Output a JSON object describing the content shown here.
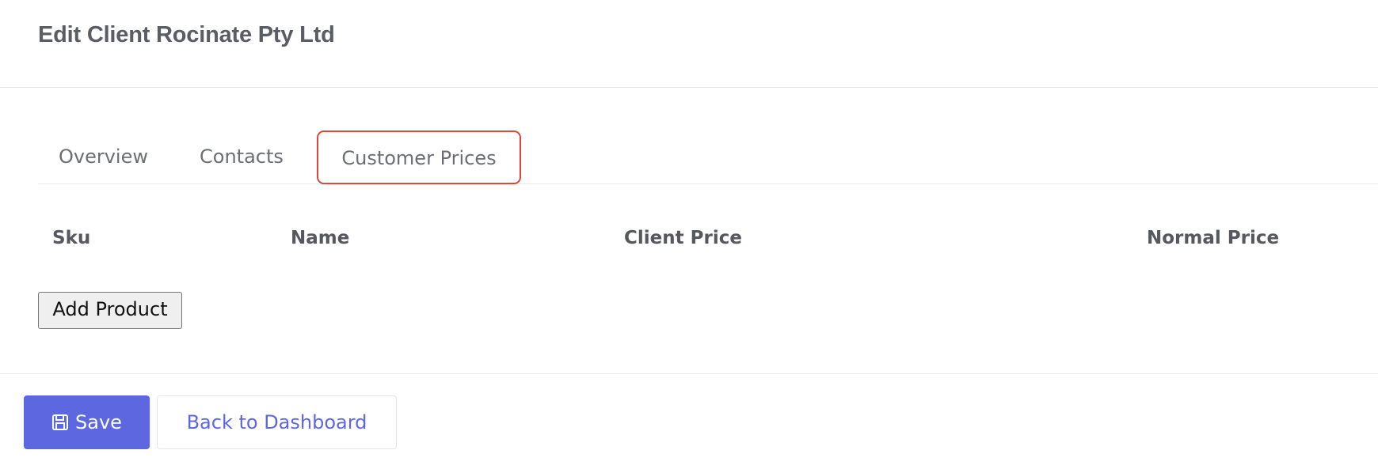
{
  "header": {
    "title": "Edit Client Rocinate Pty Ltd"
  },
  "tabs": [
    {
      "label": "Overview"
    },
    {
      "label": "Contacts"
    },
    {
      "label": "Customer Prices"
    }
  ],
  "table": {
    "columns": [
      "Sku",
      "Name",
      "Client Price",
      "Normal Price"
    ],
    "add_button_label": "Add Product"
  },
  "footer": {
    "save_label": "Save",
    "back_label": "Back to Dashboard"
  },
  "colors": {
    "primary": "#5d68e0",
    "highlight_border": "#d9483b",
    "text_muted": "#6b6e74"
  }
}
